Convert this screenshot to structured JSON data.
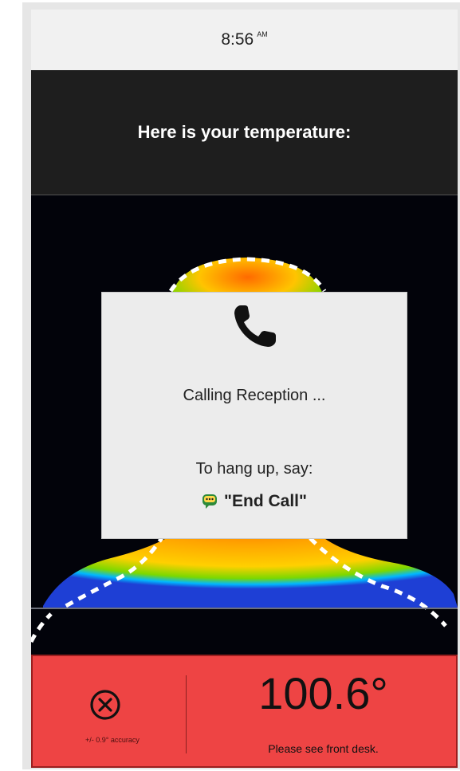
{
  "status_bar": {
    "time": "8:56",
    "ampm": "AM"
  },
  "header": {
    "title": "Here is your temperature:"
  },
  "call_dialog": {
    "icon": "phone-icon",
    "status_text": "Calling Reception ...",
    "hangup_instruction": "To hang up, say:",
    "voice_command_icon": "chat-bubble-icon",
    "voice_command": "\"End Call\""
  },
  "result": {
    "status_icon": "x-circle-icon",
    "accuracy": "+/- 0.9° accuracy",
    "temperature": "100.6°",
    "message": "Please see front desk."
  },
  "colors": {
    "result_background": "#ee4444",
    "header_background": "#1e1e1e"
  }
}
